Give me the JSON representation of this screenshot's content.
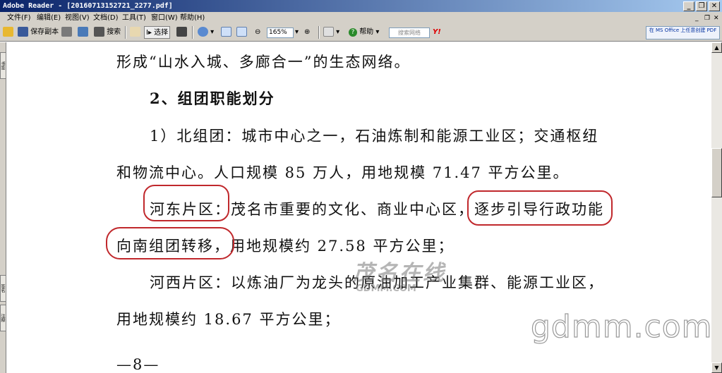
{
  "window": {
    "title": "Adobe Reader - [20160713152721_2277.pdf]"
  },
  "menu": [
    "文件(F)",
    "编辑(E)",
    "视图(V)",
    "文档(D)",
    "工具(T)",
    "窗口(W)",
    "帮助(H)"
  ],
  "toolbar": {
    "save_copy": "保存副本",
    "search": "搜索",
    "select": "选择",
    "zoom": "165%",
    "help": "帮助",
    "search_placeholder": "搜索网络",
    "yahoo": "Y!",
    "ms_office": "在 MS Office 上任意创建 PDF"
  },
  "left_tabs": [
    "书签",
    "签名",
    "注释"
  ],
  "document": {
    "l1": "形成“山水入城、多廊合一”的生态网络。",
    "heading": "2、组团职能划分",
    "l3": "1）北组团：城市中心之一，石油炼制和能源工业区；交通枢纽",
    "l4": "和物流中心。人口规模 85 万人，用地规模 71.47 平方公里。",
    "l5a": "河东片区",
    "l5b": "：茂名市重要的文化、商业中心区，",
    "l5c": "逐步引导行政功能",
    "l6a": "向南组团转移，",
    "l6b": "用地规模约 27.58 平方公里；",
    "l7": "河西片区：以炼油厂为龙头的原油加工产业集群、能源工业区，",
    "l8": "用地规模约 18.67 平方公里；",
    "page_num": "—8—"
  },
  "watermark": {
    "cn": "茂名在线",
    "url": "GDMM.COM",
    "big": "gdmm.com"
  }
}
